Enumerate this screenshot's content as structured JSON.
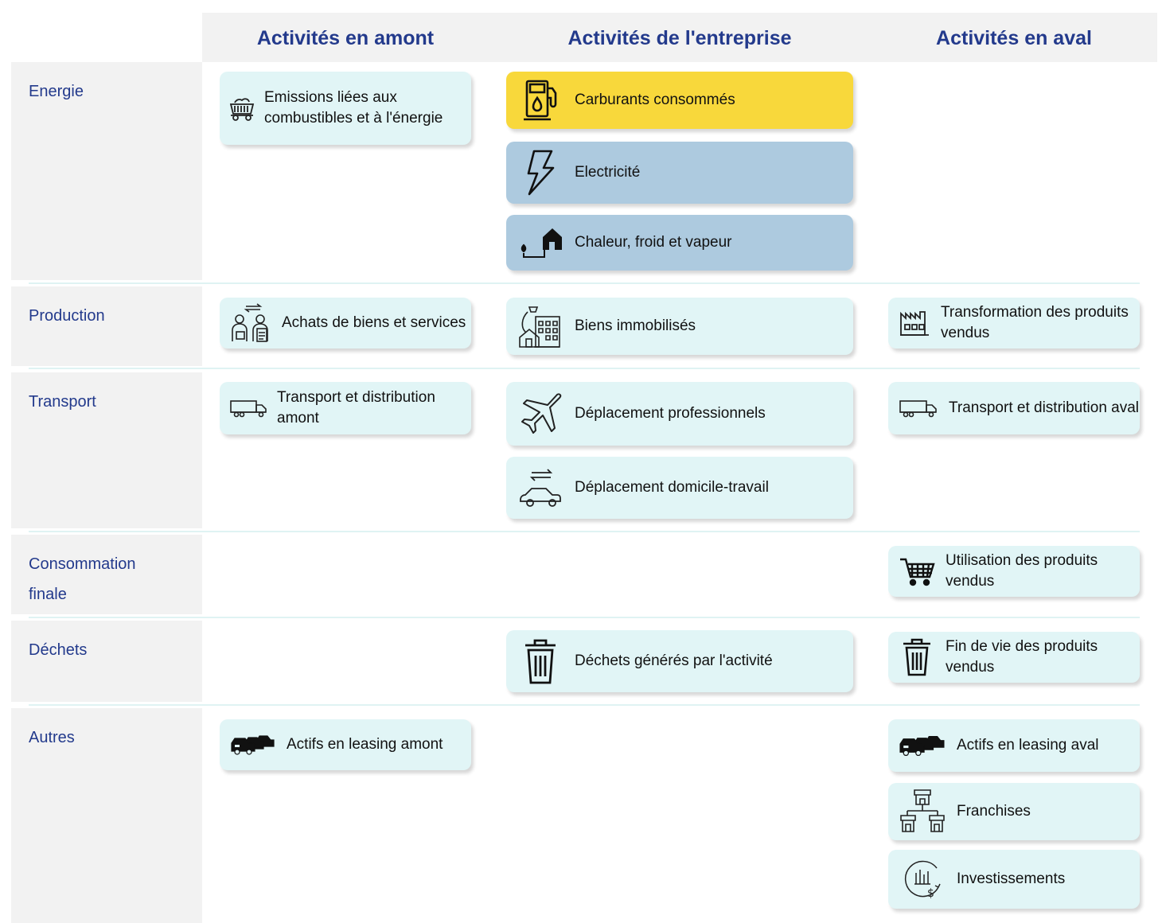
{
  "columns": [
    {
      "title": "Activités en amont"
    },
    {
      "title": "Activités de l'entreprise"
    },
    {
      "title": "Activités en aval"
    }
  ],
  "rows": [
    {
      "label": "Energie"
    },
    {
      "label": "Production"
    },
    {
      "label": "Transport"
    },
    {
      "label_line1": "Consommation",
      "label_line2": "finale"
    },
    {
      "label": "Déchets"
    },
    {
      "label": "Autres"
    }
  ],
  "cards": {
    "combustibles": {
      "text": "Emissions liées aux combustibles et à l'énergie",
      "icon": "coal-cart-icon"
    },
    "carburants": {
      "text": "Carburants consommés",
      "icon": "fuel-pump-icon",
      "color": "#f8d83b"
    },
    "electricite": {
      "text": "Electricité",
      "icon": "lightning-bolt-icon",
      "color": "#adcadf"
    },
    "chaleur": {
      "text": "Chaleur, froid et vapeur",
      "icon": "heated-house-icon",
      "color": "#adcadf"
    },
    "achats": {
      "text": "Achats de biens et services",
      "icon": "purchase-exchange-icon"
    },
    "biens_immobilises": {
      "text": "Biens immobilisés",
      "icon": "buildings-icon"
    },
    "transformation": {
      "text": "Transformation des produits vendus",
      "icon": "factory-icon"
    },
    "transport_amont": {
      "text": "Transport et distribution amont",
      "icon": "truck-icon"
    },
    "deplacement_pro": {
      "text": "Déplacement professionnels",
      "icon": "airplane-icon"
    },
    "transport_aval": {
      "text": "Transport et distribution aval",
      "icon": "truck-icon"
    },
    "domicile_travail": {
      "text": "Déplacement domicile-travail",
      "icon": "car-commute-icon"
    },
    "utilisation": {
      "text": "Utilisation des produits vendus",
      "icon": "shopping-cart-icon"
    },
    "dechets_generes": {
      "text": "Déchets générés par l'activité",
      "icon": "trash-bin-icon"
    },
    "fin_de_vie": {
      "text": "Fin de vie des produits vendus",
      "icon": "trash-bin-icon"
    },
    "leasing_amont": {
      "text": "Actifs en leasing amont",
      "icon": "car-fleet-icon"
    },
    "leasing_aval": {
      "text": "Actifs en leasing aval",
      "icon": "car-fleet-icon"
    },
    "franchises": {
      "text": "Franchises",
      "icon": "franchise-network-icon"
    },
    "investissements": {
      "text": "Investissements",
      "icon": "investment-chart-icon"
    }
  },
  "colors": {
    "header_text": "#233a8c",
    "card": "#e1f5f6",
    "yellow_card": "#f8d83b",
    "blue_card": "#adcadf",
    "band": "#f2f2f2"
  }
}
